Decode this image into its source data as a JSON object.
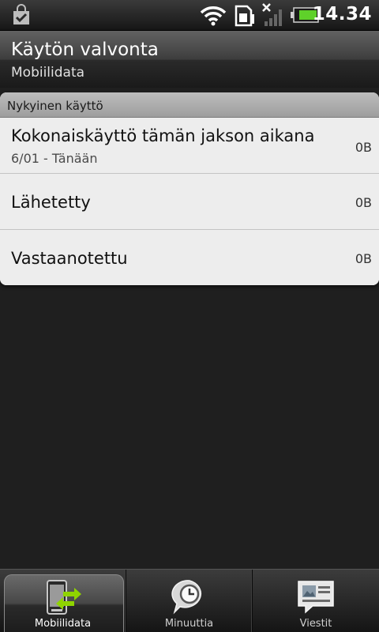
{
  "status_bar": {
    "clock": "14.34",
    "icons": [
      "market-notification-icon",
      "wifi-icon",
      "sim-card-icon",
      "no-signal-icon",
      "battery-icon"
    ],
    "colors": {
      "battery_fill": "#5fd12a"
    }
  },
  "header": {
    "title": "Käytön valvonta",
    "subtitle": "Mobiilidata"
  },
  "section": {
    "label": "Nykyinen käyttö"
  },
  "items": [
    {
      "title": "Kokonaiskäyttö tämän jakson aikana",
      "subtitle": "6/01 - Tänään",
      "value": "0B"
    },
    {
      "title": "Lähetetty",
      "value": "0B"
    },
    {
      "title": "Vastaanotettu",
      "value": "0B"
    }
  ],
  "tabs": [
    {
      "label": "Mobiilidata",
      "icon": "mobile-data-icon",
      "selected": true
    },
    {
      "label": "Minuuttia",
      "icon": "clock-bubble-icon",
      "selected": false
    },
    {
      "label": "Viestit",
      "icon": "message-icon",
      "selected": false
    }
  ],
  "colors": {
    "accent_green": "#8fd400",
    "card_background": "#ececec"
  }
}
